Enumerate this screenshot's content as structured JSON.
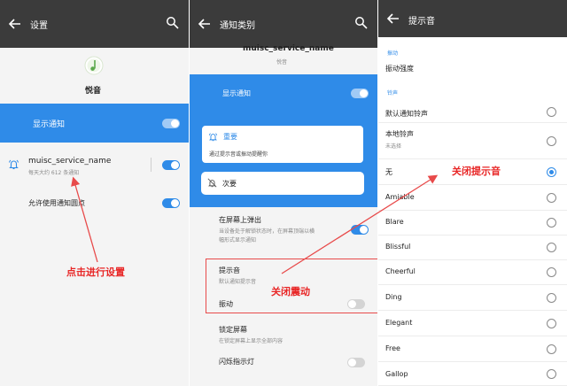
{
  "panel1": {
    "title": "设置",
    "app_name": "悦音",
    "show_notification": "显示通知",
    "channel_name": "muisc_service_name",
    "channel_sub": "每天大约 612 条通知",
    "allow_dot": "允许使用通知圆点"
  },
  "panel2": {
    "title": "通知类别",
    "channel_name": "muisc_service_name",
    "app_name": "悦音",
    "show_notification": "显示通知",
    "important": "重要",
    "important_desc": "通过提示音或振动提醒你",
    "secondary": "次要",
    "popup_title": "在屏幕上弹出",
    "popup_desc_1": "当设备处于解锁状态时，在屏幕顶端以横",
    "popup_desc_2": "幅形式显示通知",
    "sound_title": "提示音",
    "sound_sub": "默认通知提示音",
    "vibrate": "振动",
    "lock_screen": "锁定屏幕",
    "lock_screen_sub": "在锁定屏幕上显示全部内容",
    "blink_light": "闪烁指示灯"
  },
  "panel3": {
    "title": "提示音",
    "section_vibrate": "振动",
    "vibrate_strength": "振动强度",
    "section_ringtone": "铃声",
    "items": [
      {
        "label": "默认通知铃声",
        "sub": "",
        "selected": false
      },
      {
        "label": "本地铃声",
        "sub": "未选择",
        "selected": false
      },
      {
        "label": "无",
        "sub": "",
        "selected": true
      },
      {
        "label": "Amiable",
        "sub": "",
        "selected": false
      },
      {
        "label": "Blare",
        "sub": "",
        "selected": false
      },
      {
        "label": "Blissful",
        "sub": "",
        "selected": false
      },
      {
        "label": "Cheerful",
        "sub": "",
        "selected": false
      },
      {
        "label": "Ding",
        "sub": "",
        "selected": false
      },
      {
        "label": "Elegant",
        "sub": "",
        "selected": false
      },
      {
        "label": "Free",
        "sub": "",
        "selected": false
      },
      {
        "label": "Gallop",
        "sub": "",
        "selected": false
      }
    ]
  },
  "annotations": {
    "click_settings": "点击进行设置",
    "disable_vibrate": "关闭震动",
    "disable_sound": "关闭提示音"
  },
  "colors": {
    "accent": "#2f8be8",
    "topbar": "#3b3b3b",
    "annotation": "#e82626"
  }
}
